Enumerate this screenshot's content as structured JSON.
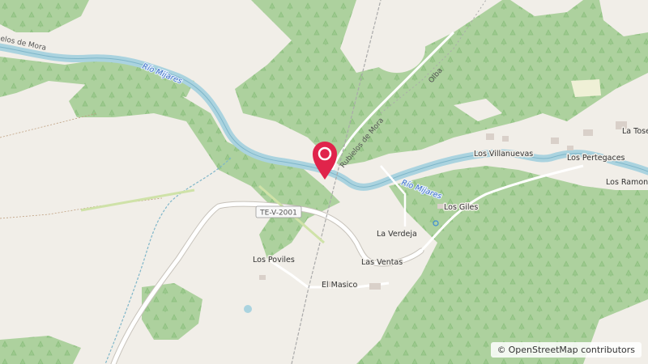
{
  "map": {
    "places": {
      "los_villanuevas": "Los Villanuevas",
      "los_pertegaces": "Los Pertegaces",
      "los_giles": "Los Giles",
      "la_verdeja": "La Verdeja",
      "las_ventas": "Las Ventas",
      "los_poviles": "Los Poviles",
      "el_masico": "El Masico",
      "la_tose": "La Tose",
      "los_ramon": "Los Ramon"
    },
    "rivers": {
      "mijares_west": "Río Mijares",
      "mijares_east": "Río Mijares"
    },
    "roads": {
      "road_shield": "TE-V-2001",
      "rubielos": "Rubielos de Mora",
      "olba": "Olba",
      "rubielos_west": "elos de Mora"
    },
    "attribution": {
      "symbol": "©",
      "text": "OpenStreetMap contributors"
    },
    "colors": {
      "forest": "#add19e",
      "background": "#f1eee8",
      "water": "#aad3df",
      "marker": "#e0244b"
    },
    "marker_icon": "map-pin-icon"
  }
}
